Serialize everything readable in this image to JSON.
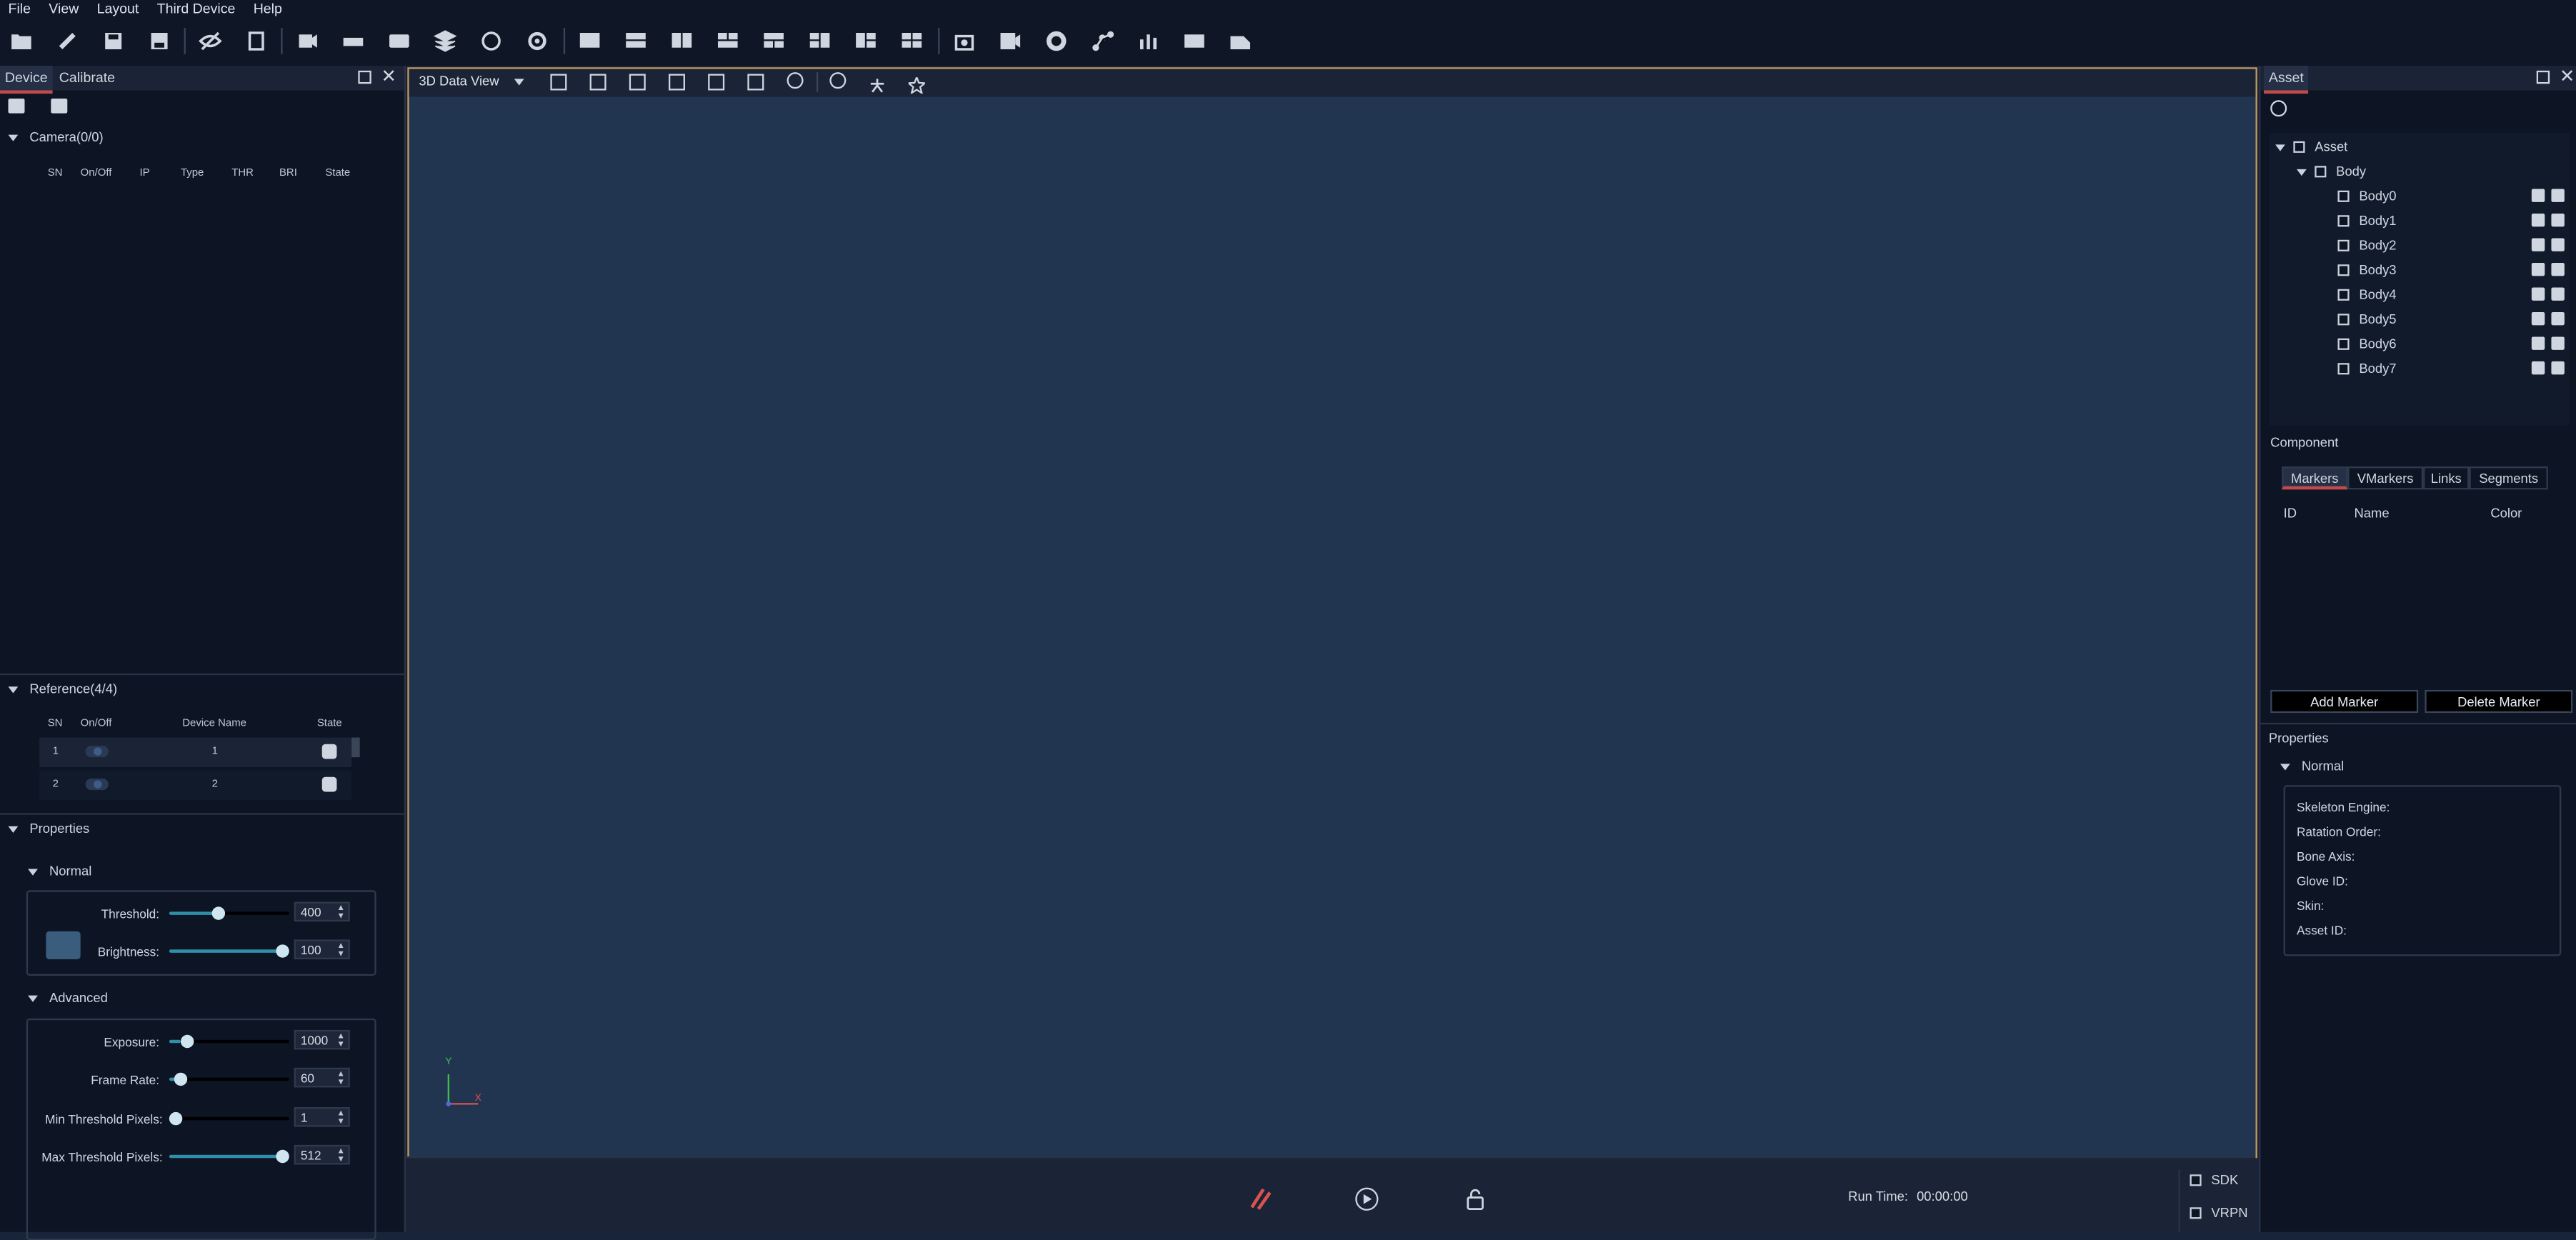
{
  "menu": [
    "File",
    "View",
    "Layout",
    "Third Device",
    "Help"
  ],
  "left_panel": {
    "tabs": [
      "Device",
      "Calibrate"
    ],
    "camera_section": {
      "title": "Camera(0/0)",
      "columns": [
        "SN",
        "On/Off",
        "IP",
        "Type",
        "THR",
        "BRI",
        "State"
      ]
    },
    "reference_section": {
      "title": "Reference(4/4)",
      "columns": [
        "SN",
        "On/Off",
        "Device Name",
        "State"
      ],
      "rows": [
        {
          "sn": "1",
          "name": "1"
        },
        {
          "sn": "2",
          "name": "2"
        }
      ]
    },
    "properties": {
      "title": "Properties",
      "normal": {
        "title": "Normal",
        "threshold": {
          "label": "Threshold:",
          "value": "400",
          "fraction": 0.4
        },
        "brightness": {
          "label": "Brightness:",
          "value": "100",
          "fraction": 1.0
        }
      },
      "advanced": {
        "title": "Advanced",
        "exposure": {
          "label": "Exposure:",
          "value": "1000",
          "fraction": 0.1
        },
        "frame_rate": {
          "label": "Frame Rate:",
          "value": "60",
          "fraction": 0.05
        },
        "min_threshold": {
          "label": "Min Threshold Pixels:",
          "value": "1",
          "fraction": 0.0
        },
        "max_threshold": {
          "label": "Max Threshold Pixels:",
          "value": "512",
          "fraction": 1.0
        }
      }
    }
  },
  "viewport": {
    "view_select": "3D Data View",
    "axis_y": "Y",
    "axis_x": "X"
  },
  "bottom": {
    "run_time_label": "Run Time:",
    "run_time_value": "00:00:00",
    "sdk_label": "SDK",
    "vrpn_label": "VRPN"
  },
  "right_panel": {
    "tab": "Asset",
    "tree_root": "Asset",
    "tree_group": "Body",
    "bodies": [
      "Body0",
      "Body1",
      "Body2",
      "Body3",
      "Body4",
      "Body5",
      "Body6",
      "Body7"
    ],
    "component_title": "Component",
    "component_tabs": [
      "Markers",
      "VMarkers",
      "Links",
      "Segments"
    ],
    "marker_columns": [
      "ID",
      "Name",
      "Color"
    ],
    "add_marker": "Add Marker",
    "delete_marker": "Delete Marker",
    "properties_title": "Properties",
    "normal_title": "Normal",
    "fields": [
      "Skeleton Engine:",
      "Ratation Order:",
      "Bone Axis:",
      "Glove ID:",
      "Skin:",
      "Asset ID:"
    ]
  },
  "colors": {
    "accent": "#2f8fa8",
    "tab_underline": "#c24a4a",
    "viewport_border": "#c59a5a",
    "viewport_bg": "#223550",
    "bottom_icon_red": "#d9534f"
  }
}
